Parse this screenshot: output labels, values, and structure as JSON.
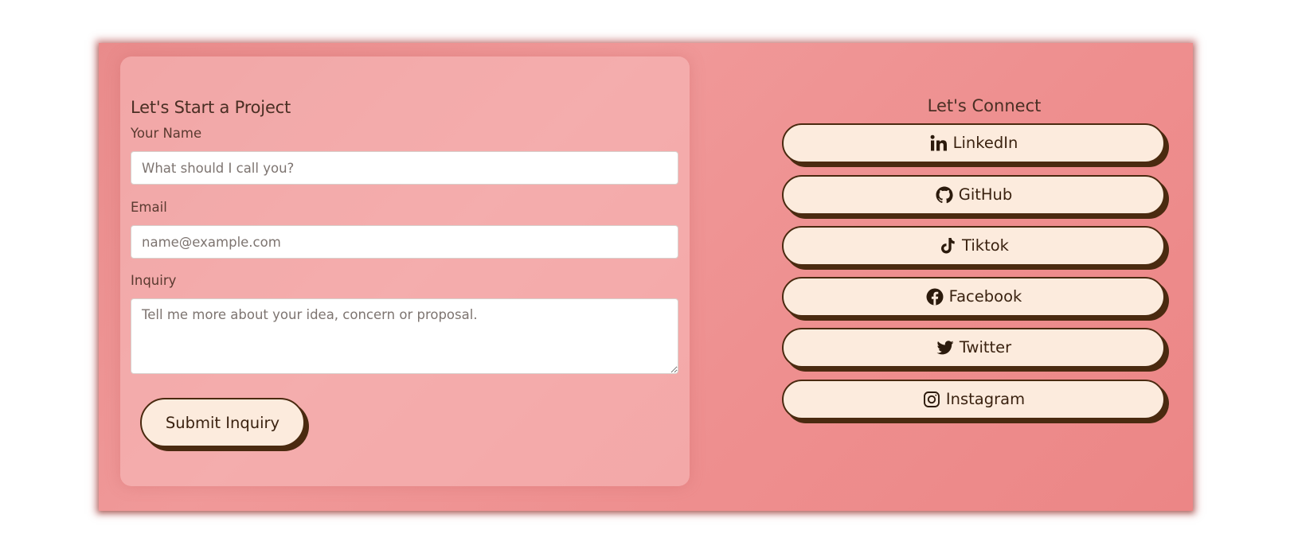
{
  "form": {
    "title": "Let's Start a Project",
    "name_label": "Your Name",
    "name_placeholder": "What should I call you?",
    "email_label": "Email",
    "email_placeholder": "name@example.com",
    "inquiry_label": "Inquiry",
    "inquiry_placeholder": "Tell me more about your idea, concern or proposal.",
    "submit_label": "Submit Inquiry"
  },
  "connect": {
    "title": "Let's Connect",
    "links": [
      {
        "label": "LinkedIn",
        "icon": "linkedin-icon"
      },
      {
        "label": "GitHub",
        "icon": "github-icon"
      },
      {
        "label": "Tiktok",
        "icon": "tiktok-icon"
      },
      {
        "label": "Facebook",
        "icon": "facebook-icon"
      },
      {
        "label": "Twitter",
        "icon": "twitter-icon"
      },
      {
        "label": "Instagram",
        "icon": "instagram-icon"
      }
    ]
  },
  "colors": {
    "card_background": "#ee9090",
    "button_background": "#fcebdd",
    "button_border": "#4a2a10",
    "text": "#4a2f24"
  }
}
